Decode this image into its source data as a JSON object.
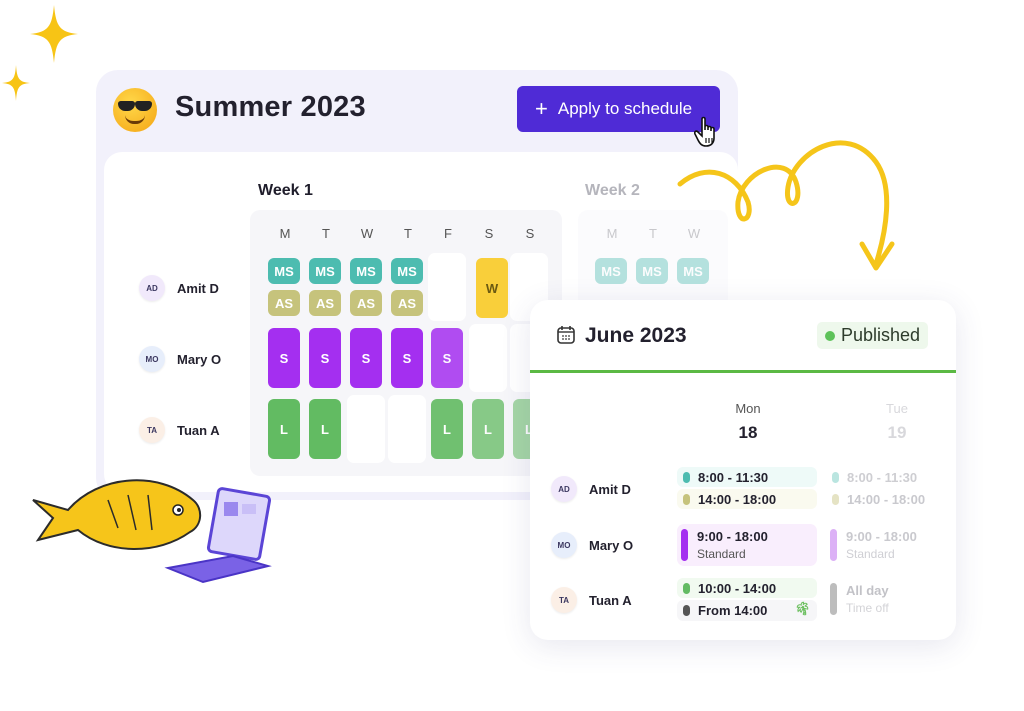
{
  "header": {
    "emoji": "sunglasses-face",
    "title": "Summer 2023",
    "apply_button": "Apply to schedule",
    "apply_icon": "+"
  },
  "weeks": [
    {
      "label": "Week 1"
    },
    {
      "label": "Week 2"
    }
  ],
  "day_headers": [
    "M",
    "T",
    "W",
    "T",
    "F",
    "S",
    "S"
  ],
  "week2_day_headers": [
    "M",
    "T",
    "W"
  ],
  "people": [
    {
      "initials": "AD",
      "name": "Amit D",
      "avatar_color": "#f1e9fb"
    },
    {
      "initials": "MO",
      "name": "Mary O",
      "avatar_color": "#e7eefb"
    },
    {
      "initials": "TA",
      "name": "Tuan A",
      "avatar_color": "#fbefe6"
    }
  ],
  "week1_shifts": {
    "amit": {
      "top": [
        "MS",
        "MS",
        "MS",
        "MS",
        "",
        "W",
        ""
      ],
      "bottom": [
        "AS",
        "AS",
        "AS",
        "AS",
        "",
        "",
        ""
      ]
    },
    "mary": [
      "S",
      "S",
      "S",
      "S",
      "S",
      "",
      ""
    ],
    "tuan": [
      "L",
      "L",
      "",
      "",
      "L",
      "L",
      "L"
    ]
  },
  "week2_shifts": {
    "amit_top": [
      "MS",
      "MS",
      "MS"
    ]
  },
  "colors": {
    "MS": "#4dbcb0",
    "AS": "#c6c37c",
    "W": "#f9cf3a",
    "S": "#a42ff0",
    "L": "#62bb62",
    "accent": "#4f2bd6",
    "published": "#5ec25a"
  },
  "card": {
    "title": "June 2023",
    "status": "Published",
    "days": [
      {
        "name": "Mon",
        "date": "18"
      },
      {
        "name": "Tue",
        "date": "19"
      }
    ],
    "rows": [
      {
        "person": "Amit D",
        "initials": "AD",
        "mon": [
          {
            "time": "8:00 - 11:30",
            "color": "#4dbcb0"
          },
          {
            "time": "14:00 - 18:00",
            "color": "#c6c37c"
          }
        ],
        "tue": [
          {
            "time": "8:00 - 11:30",
            "color": "#4dbcb0"
          },
          {
            "time": "14:00 - 18:00",
            "color": "#c6c37c"
          }
        ]
      },
      {
        "person": "Mary O",
        "initials": "MO",
        "mon": {
          "time": "9:00 - 18:00",
          "label": "Standard"
        },
        "tue": {
          "time": "9:00 - 18:00",
          "label": "Standard"
        }
      },
      {
        "person": "Tuan A",
        "initials": "TA",
        "mon": [
          {
            "time": "10:00 - 14:00",
            "color": "#62bb62"
          },
          {
            "time": "From 14:00",
            "color": "#555555",
            "icon": "palm-tree-icon"
          }
        ],
        "tue": {
          "time": "All day",
          "label": "Time off"
        }
      }
    ]
  }
}
